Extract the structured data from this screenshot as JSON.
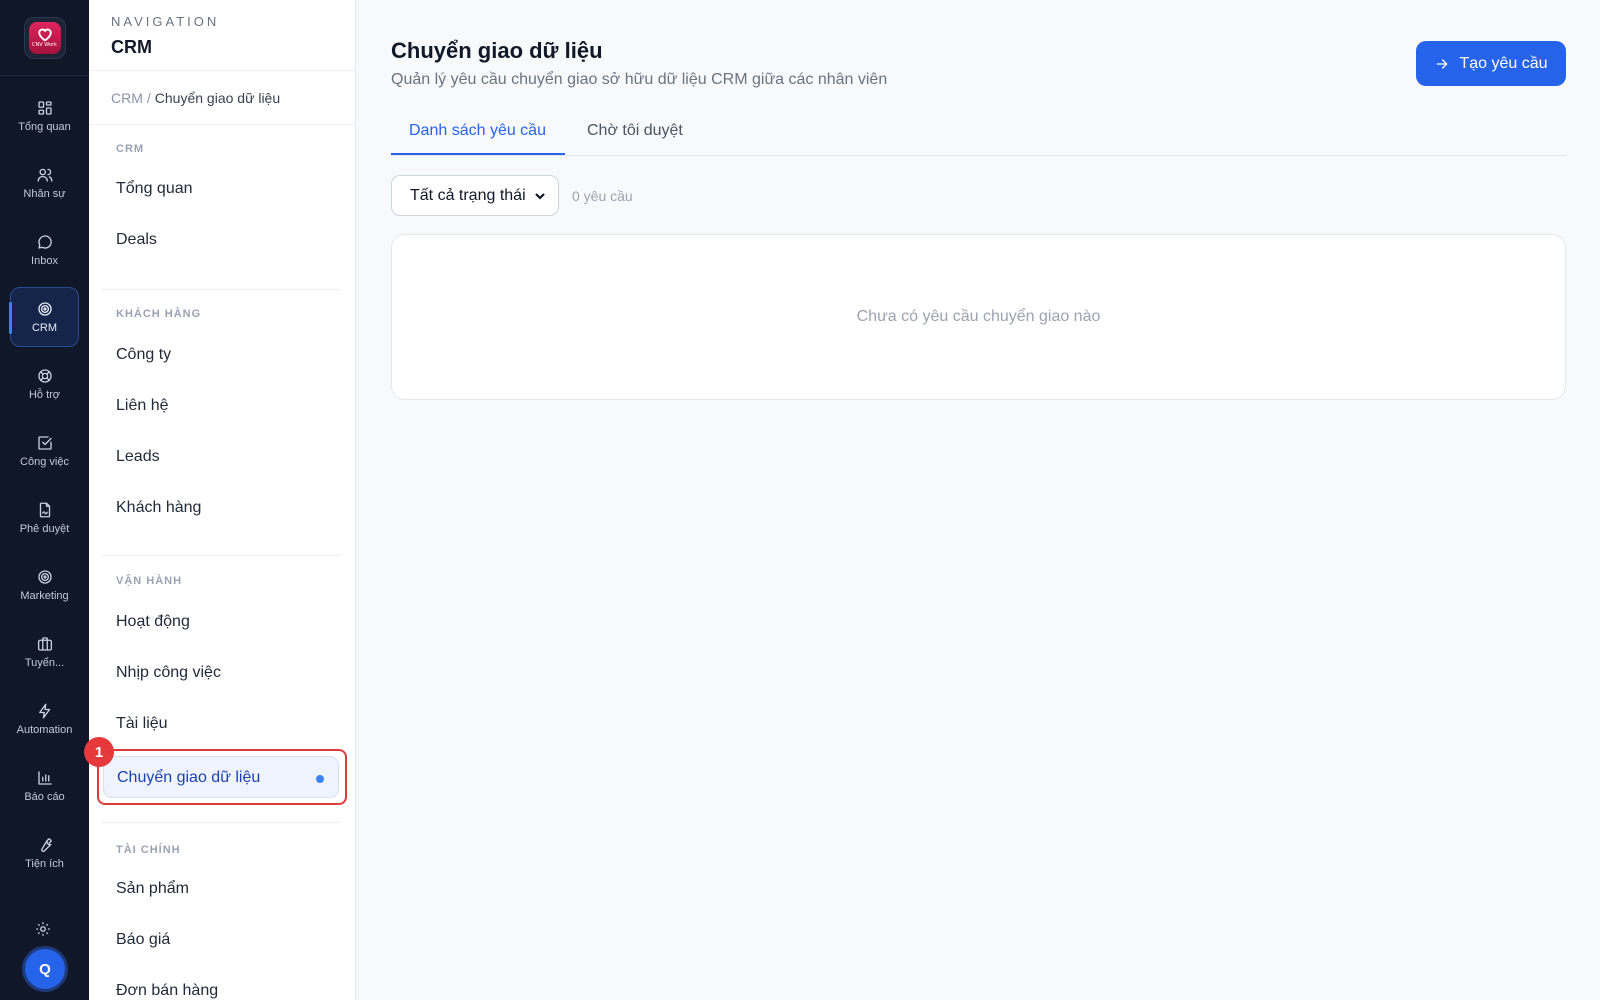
{
  "rail": {
    "logo_text": "CNV Work",
    "items": [
      {
        "label": "Tổng quan",
        "icon": "grid-icon"
      },
      {
        "label": "Nhân sự",
        "icon": "users-icon"
      },
      {
        "label": "Inbox",
        "icon": "chat-icon"
      },
      {
        "label": "CRM",
        "icon": "target-icon",
        "active": true
      },
      {
        "label": "Hỗ trợ",
        "icon": "lifebuoy-icon"
      },
      {
        "label": "Công việc",
        "icon": "check-square-icon"
      },
      {
        "label": "Phê duyệt",
        "icon": "file-sign-icon"
      },
      {
        "label": "Marketing",
        "icon": "target-icon"
      },
      {
        "label": "Tuyển...",
        "icon": "briefcase-icon"
      },
      {
        "label": "Automation",
        "icon": "bolt-icon"
      },
      {
        "label": "Báo cáo",
        "icon": "bar-chart-icon"
      },
      {
        "label": "Tiện ích",
        "icon": "wrench-icon"
      }
    ],
    "avatar_initial": "Q"
  },
  "nav": {
    "header_label": "NAVIGATION",
    "header_title": "CRM",
    "breadcrumb": {
      "root": "CRM",
      "separator": "/",
      "current": "Chuyển giao dữ liệu"
    },
    "sections": [
      {
        "title": "CRM",
        "items": [
          "Tổng quan",
          "Deals"
        ]
      },
      {
        "title": "KHÁCH HÀNG",
        "items": [
          "Công ty",
          "Liên hệ",
          "Leads",
          "Khách hàng"
        ]
      },
      {
        "title": "VẬN HÀNH",
        "items": [
          "Hoạt động",
          "Nhịp công việc",
          "Tài liệu",
          "Chuyển giao dữ liệu"
        ]
      },
      {
        "title": "TÀI CHÍNH",
        "items": [
          "Sản phẩm",
          "Báo giá",
          "Đơn bán hàng"
        ]
      }
    ],
    "active_item": "Chuyển giao dữ liệu",
    "highlight_badge": "1"
  },
  "main": {
    "title": "Chuyển giao dữ liệu",
    "subtitle": "Quản lý yêu cầu chuyển giao sở hữu dữ liệu CRM giữa các nhân viên",
    "create_button": "Tạo yêu cầu",
    "tabs": [
      {
        "label": "Danh sách yêu cầu",
        "active": true
      },
      {
        "label": "Chờ tôi duyệt",
        "active": false
      }
    ],
    "filter": {
      "selected": "Tất cả trạng thái"
    },
    "count_text": "0 yêu cầu",
    "empty_text": "Chưa có yêu cầu chuyển giao nào"
  },
  "colors": {
    "rail_bg": "#0f1729",
    "accent": "#2563eb",
    "highlight": "#e03b3b"
  }
}
